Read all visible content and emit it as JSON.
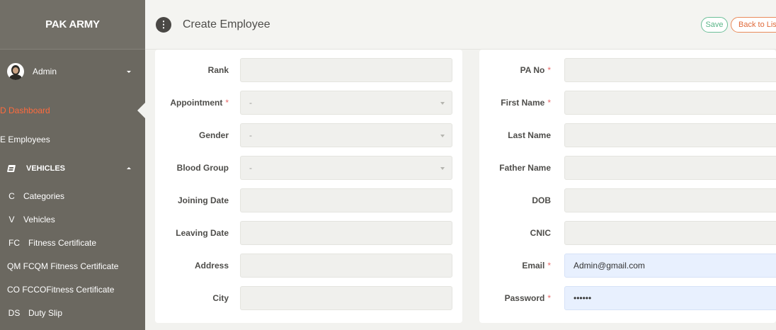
{
  "sidebar": {
    "brand": "PAK ARMY",
    "user": "Admin",
    "dashboard": "D Dashboard",
    "employees": "E Employees",
    "vehicles_group": "VEHICLES",
    "sub_items": [
      {
        "abbr": "C",
        "label": "Categories"
      },
      {
        "abbr": "V",
        "label": "Vehicles"
      },
      {
        "abbr": "FC",
        "label": "Fitness Certificate"
      },
      {
        "abbr": "QM FC",
        "label": "QM Fitness Certificate"
      },
      {
        "abbr": "CO FC",
        "label": "COFitness Certificate"
      },
      {
        "abbr": "DS",
        "label": "Duty Slip"
      }
    ]
  },
  "header": {
    "menu_icon": "⋮",
    "title": "Create Employee",
    "save": "Save",
    "back": "Back to List"
  },
  "form": {
    "left": [
      {
        "label": "Rank",
        "required": false,
        "type": "text",
        "value": ""
      },
      {
        "label": "Appointment",
        "required": true,
        "type": "select",
        "value": "-"
      },
      {
        "label": "Gender",
        "required": false,
        "type": "select",
        "value": "-"
      },
      {
        "label": "Blood Group",
        "required": false,
        "type": "select",
        "value": "-"
      },
      {
        "label": "Joining Date",
        "required": false,
        "type": "text",
        "value": ""
      },
      {
        "label": "Leaving Date",
        "required": false,
        "type": "text",
        "value": ""
      },
      {
        "label": "Address",
        "required": false,
        "type": "text",
        "value": ""
      },
      {
        "label": "City",
        "required": false,
        "type": "text",
        "value": ""
      }
    ],
    "right": [
      {
        "label": "PA No",
        "required": true,
        "type": "text",
        "value": ""
      },
      {
        "label": "First Name",
        "required": true,
        "type": "text",
        "value": ""
      },
      {
        "label": "Last Name",
        "required": false,
        "type": "text",
        "value": ""
      },
      {
        "label": "Father Name",
        "required": false,
        "type": "text",
        "value": ""
      },
      {
        "label": "DOB",
        "required": false,
        "type": "text",
        "value": ""
      },
      {
        "label": "CNIC",
        "required": false,
        "type": "text",
        "value": ""
      },
      {
        "label": "Email",
        "required": true,
        "type": "text",
        "value": "Admin@gmail.com"
      },
      {
        "label": "Password",
        "required": true,
        "type": "password",
        "value": "••••••"
      }
    ],
    "required_mark": "*"
  },
  "colors": {
    "sidebar_bg": "#6b6860",
    "active_link": "#ff6b3d",
    "save_accent": "#5ab588",
    "back_accent": "#e06a3a",
    "autofill_bg": "#e8f0fe"
  }
}
